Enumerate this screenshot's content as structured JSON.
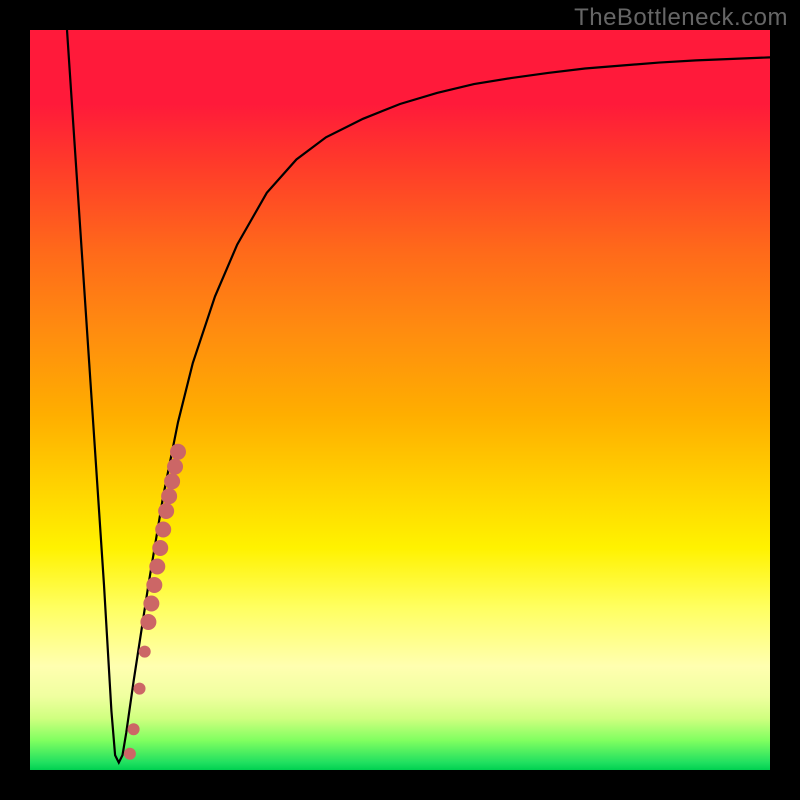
{
  "watermark": "TheBottleneck.com",
  "chart_data": {
    "type": "line",
    "title": "",
    "xlabel": "",
    "ylabel": "",
    "xlim": [
      0,
      100
    ],
    "ylim": [
      0,
      100
    ],
    "series": [
      {
        "name": "curve",
        "x": [
          5,
          6,
          8,
          10,
          11,
          11.5,
          12,
          12.5,
          13,
          14,
          16,
          18,
          20,
          22,
          25,
          28,
          32,
          36,
          40,
          45,
          50,
          55,
          60,
          65,
          70,
          75,
          80,
          85,
          90,
          95,
          100
        ],
        "values": [
          100,
          85,
          55,
          25,
          8,
          2,
          1,
          2,
          5,
          12,
          25,
          37,
          47,
          55,
          64,
          71,
          78,
          82.5,
          85.5,
          88,
          90,
          91.5,
          92.7,
          93.5,
          94.2,
          94.8,
          95.2,
          95.6,
          95.9,
          96.1,
          96.3
        ]
      }
    ],
    "markers": [
      {
        "x": 13.5,
        "y": 2.2,
        "r": 6
      },
      {
        "x": 14.0,
        "y": 5.5,
        "r": 6
      },
      {
        "x": 14.8,
        "y": 11.0,
        "r": 6
      },
      {
        "x": 15.5,
        "y": 16.0,
        "r": 6
      },
      {
        "x": 16.0,
        "y": 20.0,
        "r": 8
      },
      {
        "x": 16.4,
        "y": 22.5,
        "r": 8
      },
      {
        "x": 16.8,
        "y": 25.0,
        "r": 8
      },
      {
        "x": 17.2,
        "y": 27.5,
        "r": 8
      },
      {
        "x": 17.6,
        "y": 30.0,
        "r": 8
      },
      {
        "x": 18.0,
        "y": 32.5,
        "r": 8
      },
      {
        "x": 18.4,
        "y": 35.0,
        "r": 8
      },
      {
        "x": 18.8,
        "y": 37.0,
        "r": 8
      },
      {
        "x": 19.2,
        "y": 39.0,
        "r": 8
      },
      {
        "x": 19.6,
        "y": 41.0,
        "r": 8
      },
      {
        "x": 20.0,
        "y": 43.0,
        "r": 8
      }
    ],
    "marker_color": "#cc6666"
  }
}
